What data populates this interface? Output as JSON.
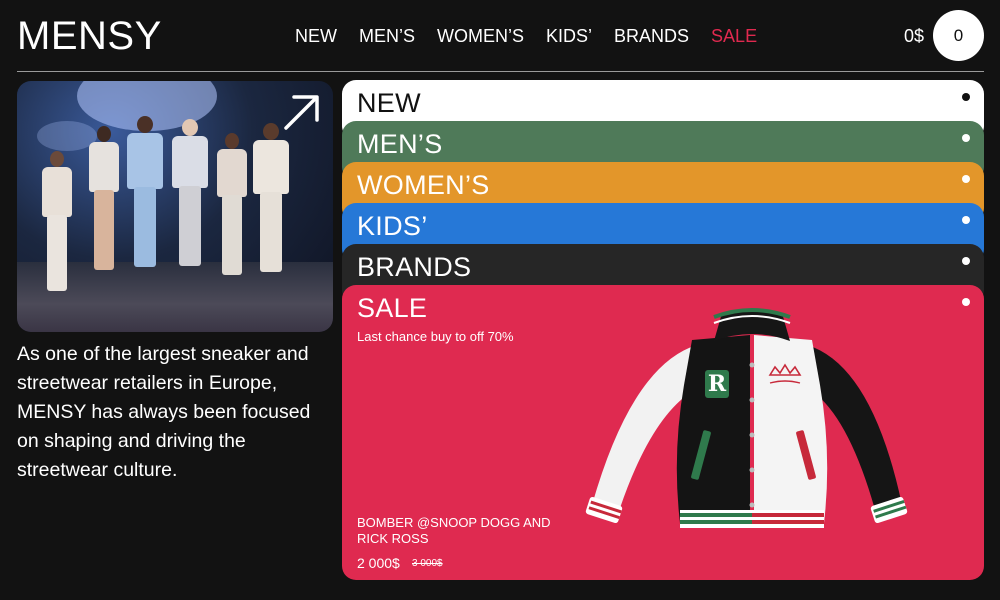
{
  "header": {
    "logo": "MENSY",
    "nav": [
      "NEW",
      "MEN’S",
      "WOMEN’S",
      "KIDS’",
      "BRANDS",
      "SALE"
    ],
    "balance": "0$",
    "cart_count": "0"
  },
  "about": "As one of the largest sneaker and streetwear retailers in Europe, MENSY has always been focused on shaping and driving the streetwear culture.",
  "categories": [
    "NEW",
    "MEN’S",
    "WOMEN’S",
    "KIDS’",
    "BRANDS",
    "SALE"
  ],
  "sale": {
    "subtitle": "Last chance buy to off 70%",
    "product_name": "BOMBER @SNOOP DOGG AND RICK ROSS",
    "price": "2 000$",
    "old_price": "3 000$"
  },
  "icons": {
    "hero_link": "arrow-up-right-icon",
    "category_marker": "dot-icon"
  },
  "colors": {
    "background": "#121212",
    "sale_accent": "#e0294f",
    "new": "#ffffff",
    "mens": "#4f7a59",
    "womens": "#e3962a",
    "kids": "#2678d7",
    "brands": "#262626",
    "sale": "#df2a50"
  }
}
